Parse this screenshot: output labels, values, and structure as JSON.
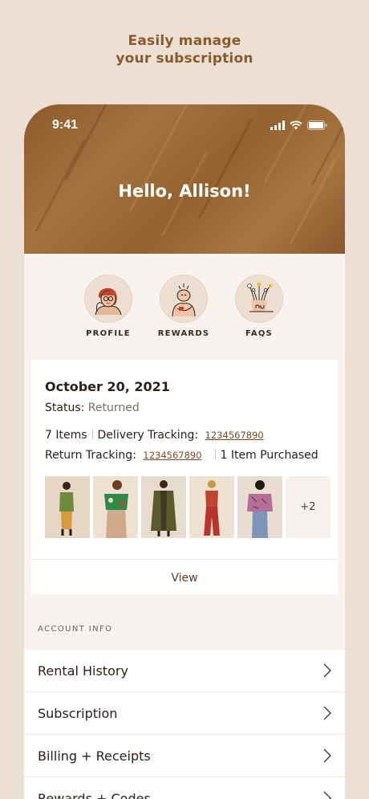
{
  "headline": {
    "line1": "Easily manage",
    "line2": "your subscription"
  },
  "status_bar": {
    "time": "9:41"
  },
  "greeting": "Hello, Allison!",
  "shortcuts": [
    {
      "label": "PROFILE",
      "icon": "profile-illustration-icon"
    },
    {
      "label": "REWARDS",
      "icon": "rewards-illustration-icon"
    },
    {
      "label": "FAQS",
      "icon": "faqs-illustration-icon"
    }
  ],
  "order": {
    "date": "October 20, 2021",
    "status_label": "Status:",
    "status_value": "Returned",
    "items_count": "7 Items",
    "delivery_label": "Delivery Tracking:",
    "delivery_number": "1234567890",
    "return_label": "Return Tracking:",
    "return_number": "1234567890",
    "purchased": "1 Item Purchased",
    "more_count": "+2",
    "view_label": "View"
  },
  "account": {
    "section_label": "ACCOUNT INFO",
    "items": [
      {
        "label": "Rental History"
      },
      {
        "label": "Subscription"
      },
      {
        "label": "Billing + Receipts"
      },
      {
        "label": "Rewards + Codes"
      }
    ]
  },
  "colors": {
    "page_bg": "#ecdfd4",
    "accent_brown": "#8a5a2c",
    "hero_brown": "#9b6a36",
    "link": "#7b4a23"
  }
}
